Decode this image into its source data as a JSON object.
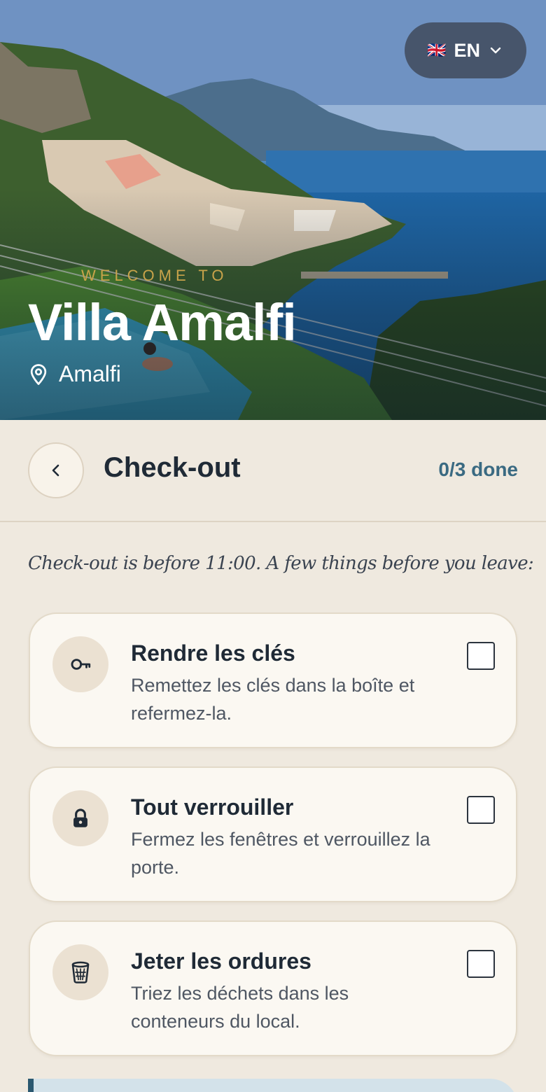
{
  "hero": {
    "language": {
      "flag": "🇬🇧",
      "code": "EN",
      "icon": "chevron-down-icon"
    },
    "welcome": "WELCOME TO",
    "title": "Villa Amalfi",
    "location": "Amalfi",
    "location_icon": "map-pin-icon"
  },
  "header": {
    "back_icon": "chevron-left-icon",
    "title": "Check-out",
    "progress": "0/3 done"
  },
  "intro": "Check-out is before 11:00. A few things before you leave:",
  "tasks": [
    {
      "icon": "key-icon",
      "title": "Rendre les clés",
      "description": "Remettez les clés dans la boîte et refermez-la.",
      "checked": false
    },
    {
      "icon": "lock-icon",
      "title": "Tout verrouiller",
      "description": "Fermez les fenêtres et verrouillez la porte.",
      "checked": false
    },
    {
      "icon": "trash-bin-icon",
      "title": "Jeter les ordures",
      "description": "Triez les déchets dans les conteneurs du local.",
      "checked": false
    }
  ],
  "colors": {
    "background": "#efe9df",
    "card": "#fbf8f2",
    "accent_teal": "#3a6a82",
    "gold": "#c9a34a",
    "text": "#1f2a36"
  }
}
